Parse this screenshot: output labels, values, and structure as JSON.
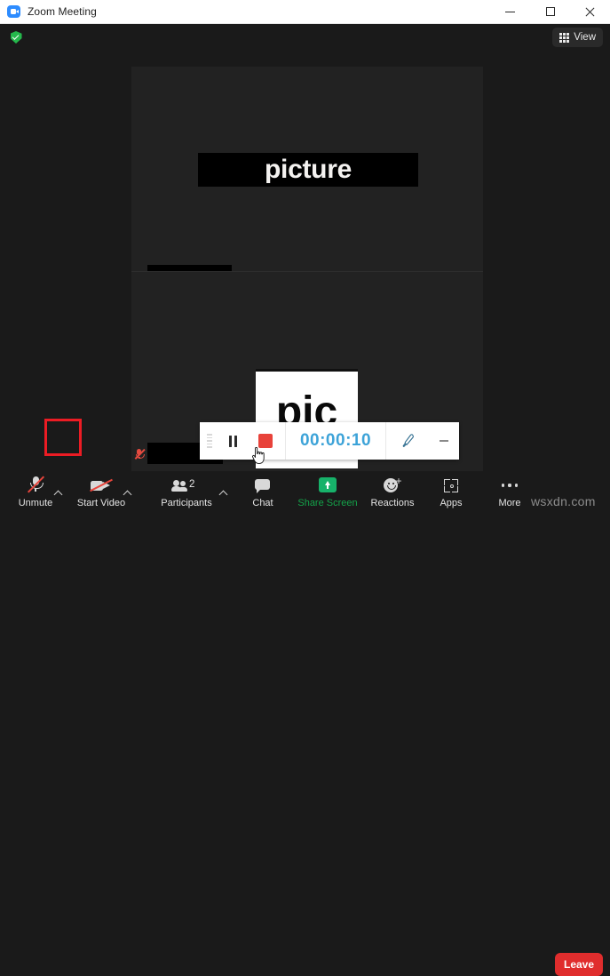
{
  "window": {
    "title": "Zoom Meeting",
    "app_icon": "zoom-logo-icon",
    "minimize_label": "",
    "maximize_label": "",
    "close_label": ""
  },
  "topbar": {
    "security_icon": "green-shield-check-icon",
    "view_label": "View",
    "view_icon": "grid-icon"
  },
  "stage": {
    "top_tile": {
      "banner_text": "picture",
      "nameplate_redacted": true,
      "mic_status": "muted"
    },
    "bottom_tile": {
      "card_text": "pic",
      "nameplate_redacted": true,
      "mic_status": "muted"
    }
  },
  "recording_toolbar": {
    "handle_icon": "drag-handle-icon",
    "pause_icon": "pause-icon",
    "stop_icon": "stop-recording-icon",
    "stop_highlighted": true,
    "timer": "00:00:10",
    "pen_icon": "pen-annotate-icon",
    "minimize_icon": "minimize-icon",
    "highlight_color": "#ec1c24",
    "timer_color": "#3da3d8",
    "stop_color": "#e8423a"
  },
  "bottombar": {
    "items": [
      {
        "label": "Unmute",
        "icon": "microphone-muted-icon",
        "caret": true,
        "count": null,
        "accent": null
      },
      {
        "label": "Start Video",
        "icon": "camera-off-icon",
        "caret": true,
        "count": null,
        "accent": null
      },
      {
        "label": "Participants",
        "icon": "participants-icon",
        "caret": true,
        "count": "2",
        "accent": null
      },
      {
        "label": "Chat",
        "icon": "chat-bubble-icon",
        "caret": false,
        "count": null,
        "accent": null
      },
      {
        "label": "Share Screen",
        "icon": "share-screen-icon",
        "caret": false,
        "count": null,
        "accent": "#14a44a"
      },
      {
        "label": "Reactions",
        "icon": "reactions-icon",
        "caret": false,
        "count": null,
        "accent": null
      },
      {
        "label": "Apps",
        "icon": "apps-icon",
        "caret": false,
        "count": null,
        "accent": null
      },
      {
        "label": "More",
        "icon": "more-dots-icon",
        "caret": false,
        "count": null,
        "accent": null
      }
    ],
    "leave_label": "Leave",
    "leave_color": "#e02d2d"
  },
  "watermark": "wsxdn.com"
}
